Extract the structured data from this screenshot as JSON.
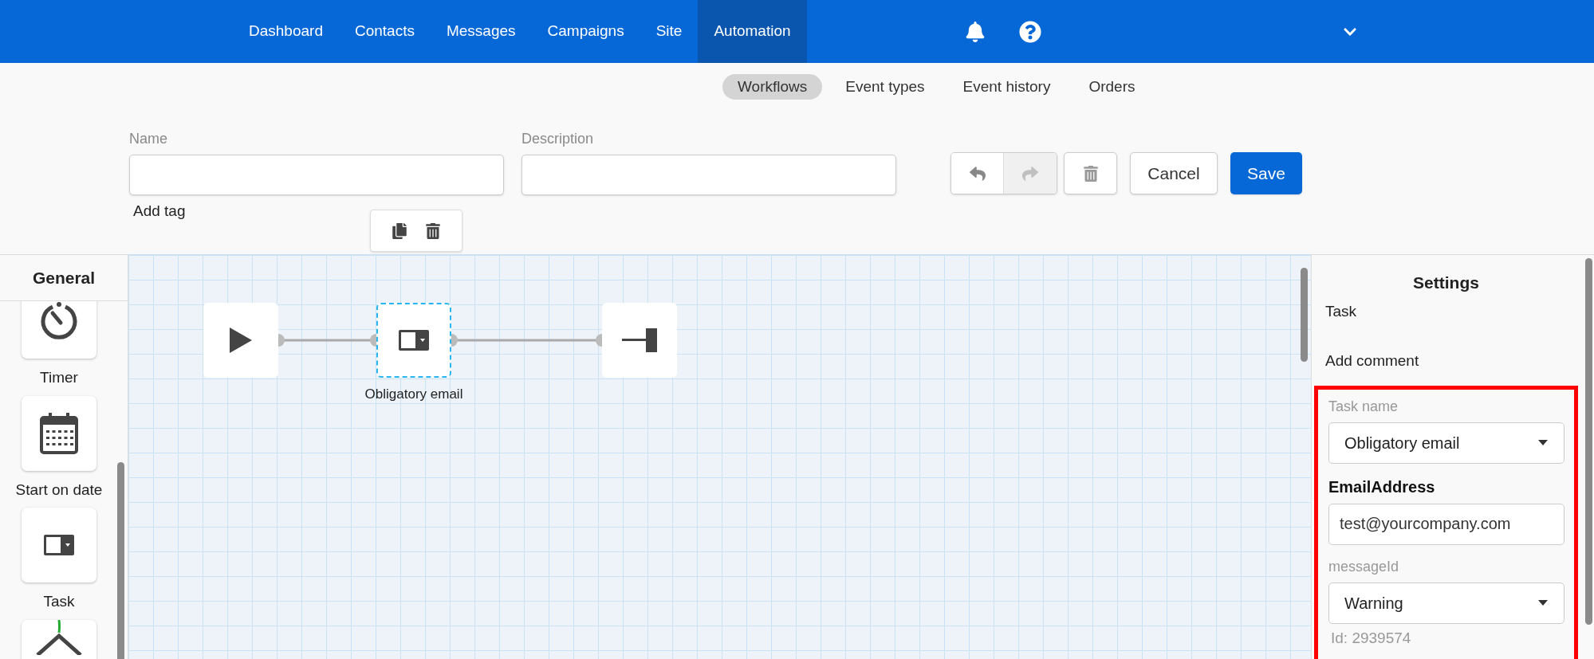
{
  "nav": {
    "items": [
      {
        "label": "Dashboard",
        "selected": false
      },
      {
        "label": "Contacts",
        "selected": false
      },
      {
        "label": "Messages",
        "selected": false
      },
      {
        "label": "Campaigns",
        "selected": false
      },
      {
        "label": "Site",
        "selected": false
      },
      {
        "label": "Automation",
        "selected": true
      }
    ]
  },
  "subnav": [
    {
      "label": "Workflows",
      "selected": true
    },
    {
      "label": "Event types",
      "selected": false
    },
    {
      "label": "Event history",
      "selected": false
    },
    {
      "label": "Orders",
      "selected": false
    }
  ],
  "form": {
    "fields": [
      {
        "label": "Name"
      },
      {
        "label": "Description"
      }
    ],
    "history": {
      "undo_disabled": false,
      "redo_disabled": true
    },
    "actions": [
      {
        "label": "Cancel",
        "kind": "secondary"
      },
      {
        "label": "Save",
        "kind": "primary"
      }
    ],
    "add_tag": "Add tag"
  },
  "palette": {
    "title": "General",
    "items": [
      {
        "label": "Timer",
        "kind": "timer"
      },
      {
        "label": "Start on date",
        "kind": "calendar"
      },
      {
        "label": "Task",
        "kind": "task"
      },
      {
        "kind": "decision"
      }
    ]
  },
  "canvas": {
    "nodes": [
      {
        "kind": "start",
        "selected": false
      },
      {
        "kind": "task",
        "label": "Obligatory email",
        "selected": true
      },
      {
        "kind": "end",
        "selected": false
      }
    ]
  },
  "settings": {
    "title": "Settings",
    "type": "Task",
    "add_comment": "Add comment",
    "highlighted": true,
    "fields": [
      {
        "kind": "select",
        "label": "Task name",
        "bold": false,
        "value": "Obligatory email"
      },
      {
        "kind": "text",
        "label": "EmailAddress",
        "bold": true,
        "value": "test@yourcompany.com"
      },
      {
        "kind": "select",
        "label": "messageId",
        "bold": false,
        "value": "Warning"
      }
    ],
    "id_text": "Id: 2939574"
  }
}
